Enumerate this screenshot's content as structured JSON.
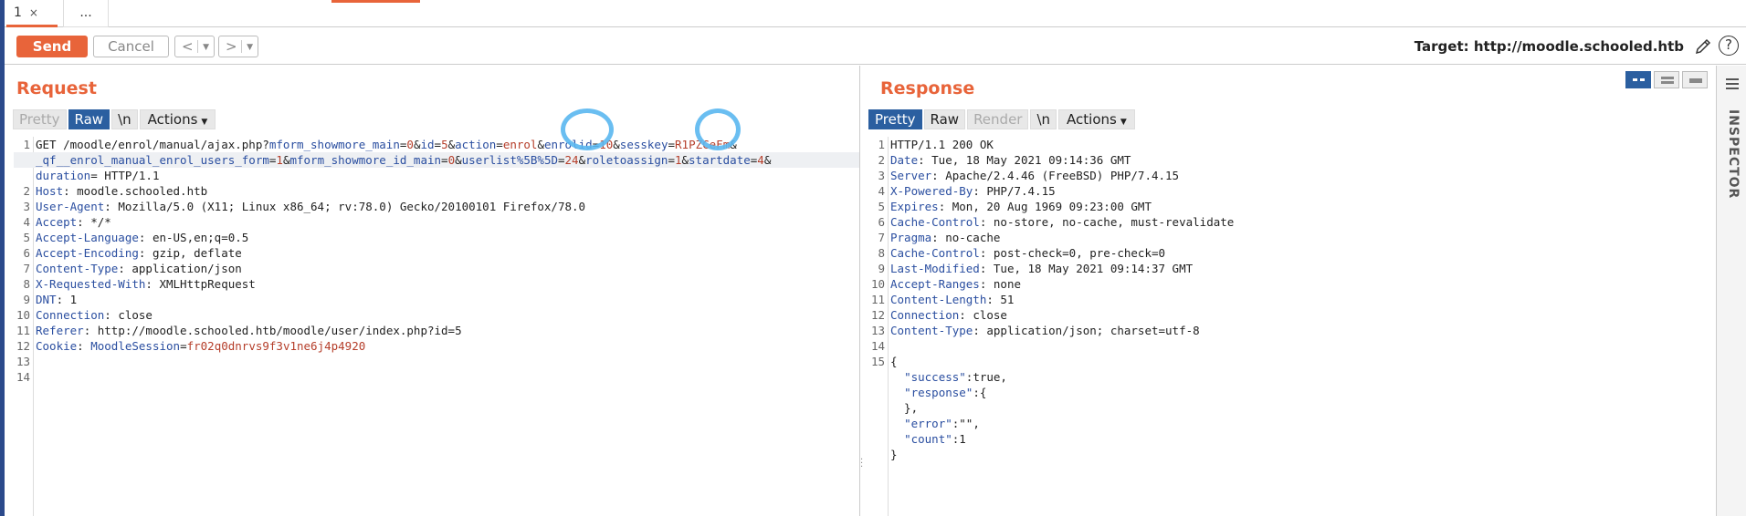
{
  "tabs": [
    {
      "label": "1",
      "close": "×"
    },
    {
      "label": "..."
    }
  ],
  "toolbar": {
    "send_label": "Send",
    "cancel_label": "Cancel",
    "back_label": "<",
    "forward_label": ">",
    "target_text": "Target: http://moodle.schooled.htb",
    "help_label": "?"
  },
  "request": {
    "title": "Request",
    "buttons": [
      "Pretty",
      "Raw",
      "\\n",
      "Actions"
    ],
    "lines": [
      {
        "n": "1",
        "html": "GET /moodle/enrol/manual/ajax.php?<span class=\"k\">mform_showmore_main</span>=<span class=\"v\">0</span>&amp;<span class=\"k\">id</span>=<span class=\"v\">5</span>&amp;<span class=\"k\">action</span>=<span class=\"v\">enrol</span>&amp;<span class=\"k\">enrolid</span>=<span class=\"v\">10</span>&amp;<span class=\"k\">sesskey</span>=<span class=\"v\">R1PZCeFm</span>&amp;"
      },
      {
        "n": "",
        "html": "<span class=\"k\">_qf__enrol_manual_enrol_users_form</span>=<span class=\"v\">1</span>&amp;<span class=\"k\">mform_showmore_id_main</span>=<span class=\"v\">0</span>&amp;<span class=\"k\">userlist%5B%5D</span>=<span class=\"v\">24</span>&amp;<span class=\"k\">roletoassign</span>=<span class=\"v\">1</span>&amp;<span class=\"k\">startdate</span>=<span class=\"v\">4</span>&amp;"
      },
      {
        "n": "",
        "html": "<span class=\"k\">duration</span>= HTTP/1.1"
      },
      {
        "n": "2",
        "html": "<span class=\"k\">Host</span>: moodle.schooled.htb"
      },
      {
        "n": "3",
        "html": "<span class=\"k\">User-Agent</span>: Mozilla/5.0 (X11; Linux x86_64; rv:78.0) Gecko/20100101 Firefox/78.0"
      },
      {
        "n": "4",
        "html": "<span class=\"k\">Accept</span>: */*"
      },
      {
        "n": "5",
        "html": "<span class=\"k\">Accept-Language</span>: en-US,en;q=0.5"
      },
      {
        "n": "6",
        "html": "<span class=\"k\">Accept-Encoding</span>: gzip, deflate"
      },
      {
        "n": "7",
        "html": "<span class=\"k\">Content-Type</span>: application/json"
      },
      {
        "n": "8",
        "html": "<span class=\"k\">X-Requested-With</span>: XMLHttpRequest"
      },
      {
        "n": "9",
        "html": "<span class=\"k\">DNT</span>: 1"
      },
      {
        "n": "10",
        "html": "<span class=\"k\">Connection</span>: close"
      },
      {
        "n": "11",
        "html": "<span class=\"k\">Referer</span>: http://moodle.schooled.htb/moodle/user/index.php?id=5"
      },
      {
        "n": "12",
        "html": "<span class=\"k\">Cookie</span>: <span class=\"k\">MoodleSession</span>=<span class=\"v\">fr02q0dnrvs9f3v1ne6j4p4920</span>"
      },
      {
        "n": "13",
        "html": ""
      },
      {
        "n": "14",
        "html": ""
      }
    ]
  },
  "response": {
    "title": "Response",
    "buttons": [
      "Pretty",
      "Raw",
      "Render",
      "\\n",
      "Actions"
    ],
    "lines": [
      {
        "n": "1",
        "html": "HTTP/1.1 200 OK"
      },
      {
        "n": "2",
        "html": "<span class=\"k\">Date</span>: Tue, 18 May 2021 09:14:36 GMT"
      },
      {
        "n": "3",
        "html": "<span class=\"k\">Server</span>: Apache/2.4.46 (FreeBSD) PHP/7.4.15"
      },
      {
        "n": "4",
        "html": "<span class=\"k\">X-Powered-By</span>: PHP/7.4.15"
      },
      {
        "n": "5",
        "html": "<span class=\"k\">Expires</span>: Mon, 20 Aug 1969 09:23:00 GMT"
      },
      {
        "n": "6",
        "html": "<span class=\"k\">Cache-Control</span>: no-store, no-cache, must-revalidate"
      },
      {
        "n": "7",
        "html": "<span class=\"k\">Pragma</span>: no-cache"
      },
      {
        "n": "8",
        "html": "<span class=\"k\">Cache-Control</span>: post-check=0, pre-check=0"
      },
      {
        "n": "9",
        "html": "<span class=\"k\">Last-Modified</span>: Tue, 18 May 2021 09:14:37 GMT"
      },
      {
        "n": "10",
        "html": "<span class=\"k\">Accept-Ranges</span>: none"
      },
      {
        "n": "11",
        "html": "<span class=\"k\">Content-Length</span>: 51"
      },
      {
        "n": "12",
        "html": "<span class=\"k\">Connection</span>: close"
      },
      {
        "n": "13",
        "html": "<span class=\"k\">Content-Type</span>: application/json; charset=utf-8"
      },
      {
        "n": "14",
        "html": ""
      },
      {
        "n": "15",
        "html": "{"
      },
      {
        "n": "",
        "html": "  <span class=\"k\">\"success\"</span>:true,"
      },
      {
        "n": "",
        "html": "  <span class=\"k\">\"response\"</span>:{"
      },
      {
        "n": "",
        "html": "  },"
      },
      {
        "n": "",
        "html": "  <span class=\"k\">\"error\"</span>:\"\","
      },
      {
        "n": "",
        "html": "  <span class=\"k\">\"count\"</span>:1"
      },
      {
        "n": "",
        "html": "}"
      }
    ]
  },
  "inspector": {
    "label": "INSPECTOR"
  },
  "colors": {
    "accent": "#e8643a",
    "active": "#2b5fa0",
    "annotation": "#5ab7f0"
  }
}
